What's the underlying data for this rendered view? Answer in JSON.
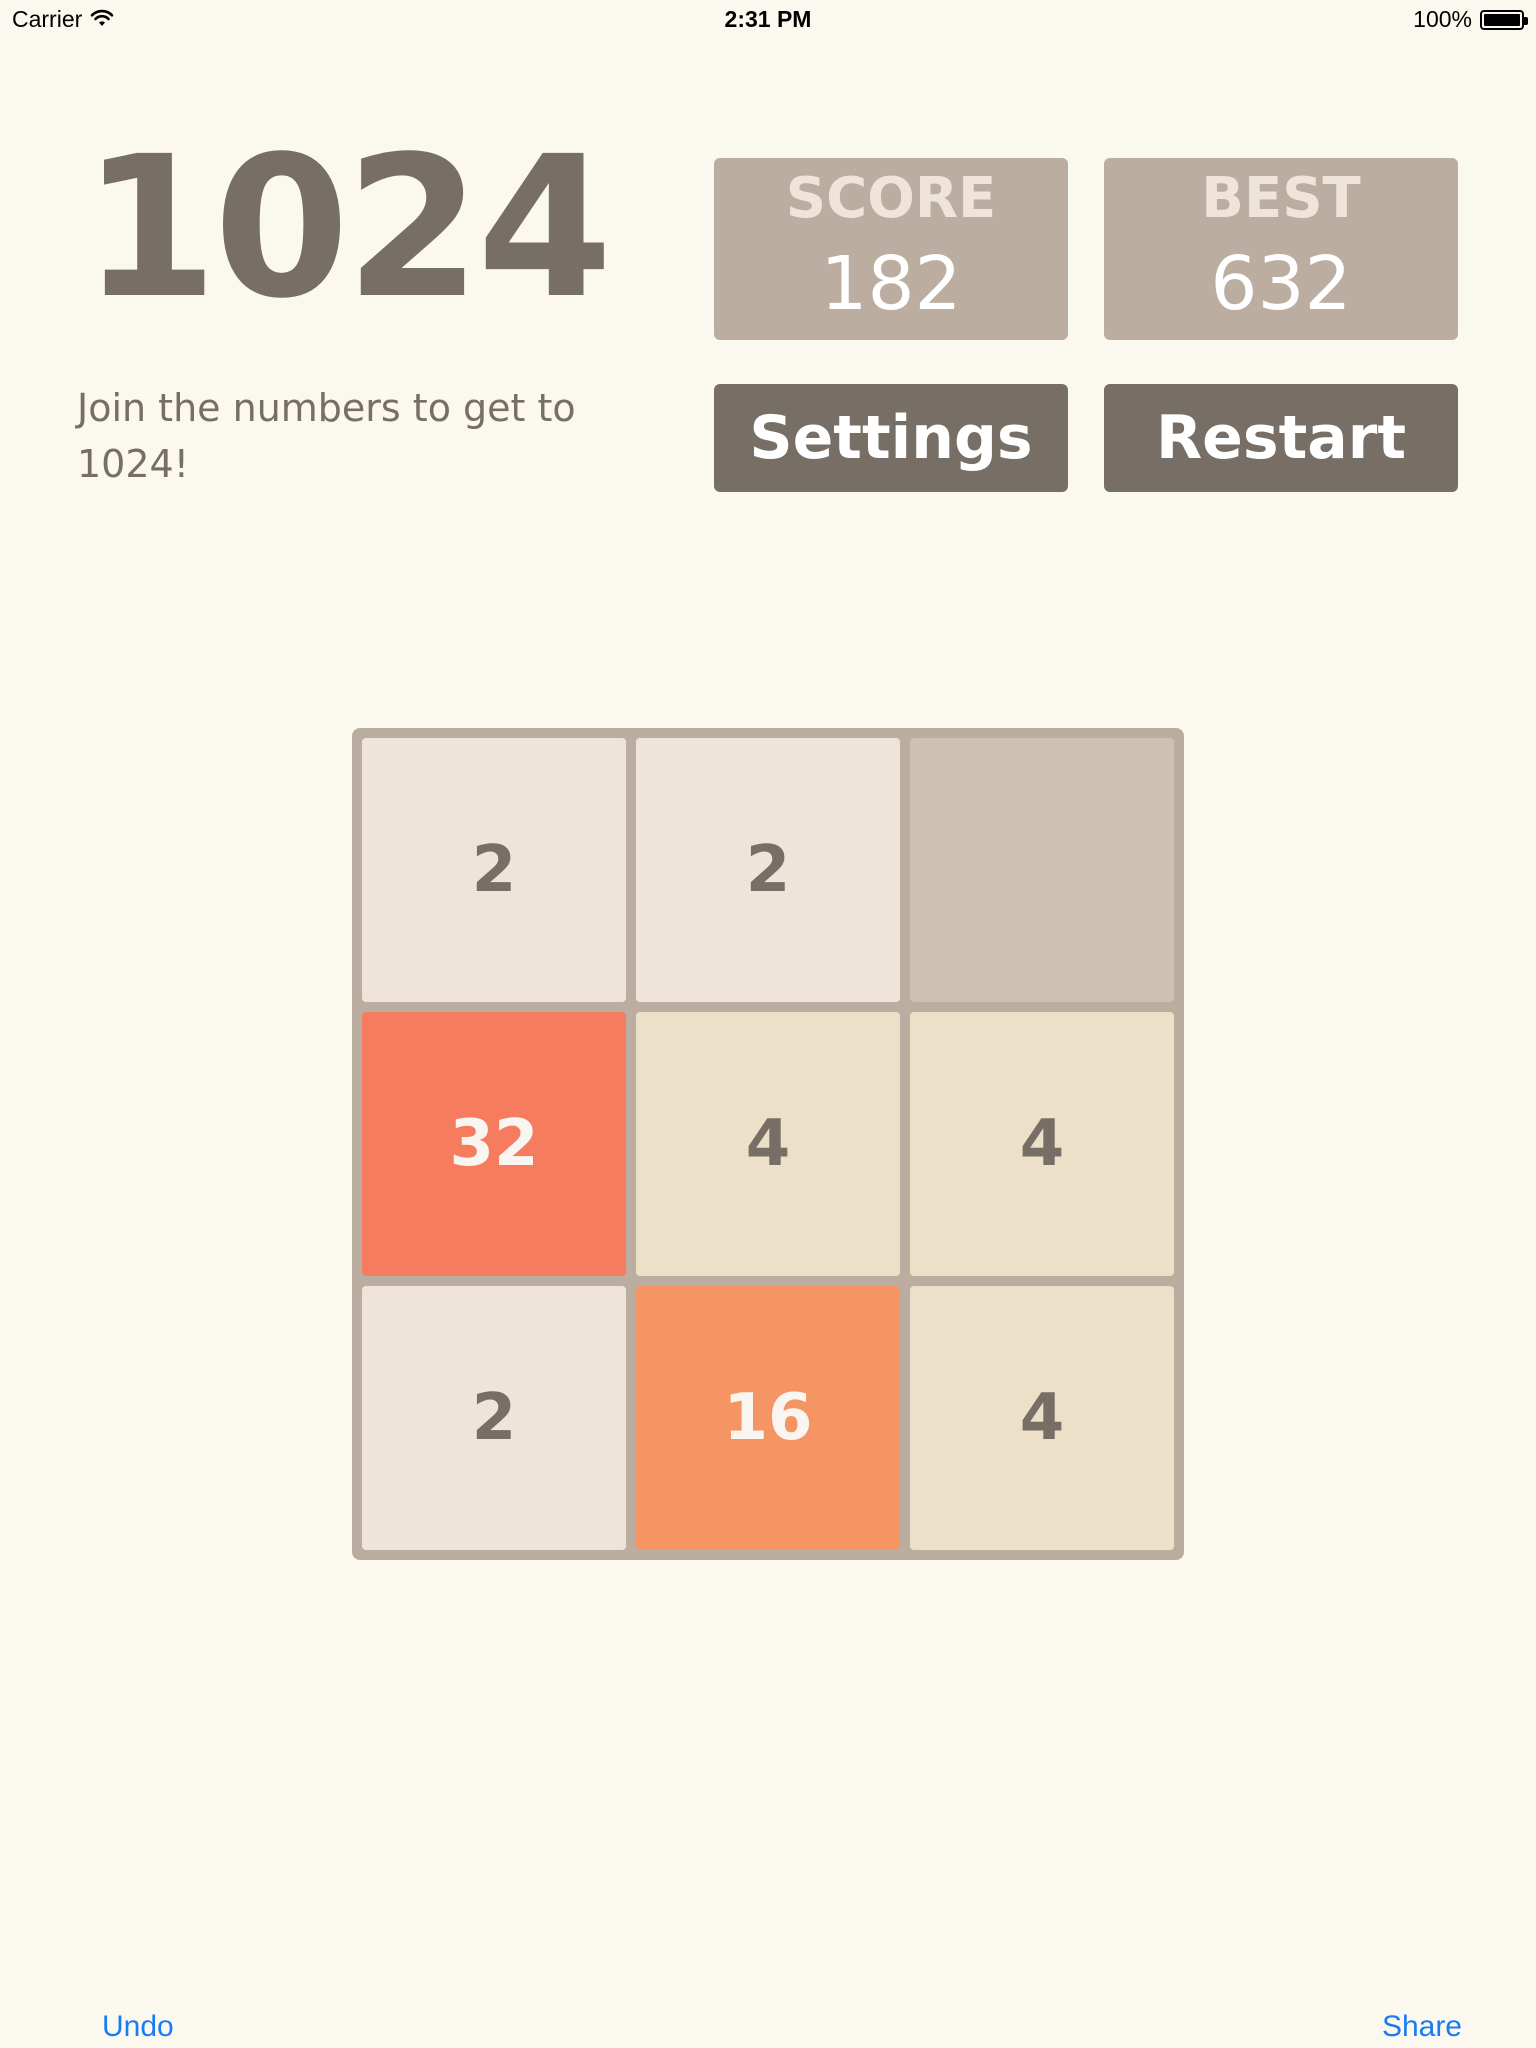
{
  "status_bar": {
    "carrier": "Carrier",
    "time": "2:31 PM",
    "battery": "100%",
    "icons": [
      "wifi-icon",
      "battery-icon"
    ]
  },
  "header": {
    "title": "1024",
    "subtitle": "Join the numbers to get to 1024!"
  },
  "scores": {
    "score_label": "SCORE",
    "score_value": "182",
    "best_label": "BEST",
    "best_value": "632"
  },
  "buttons": {
    "settings": "Settings",
    "restart": "Restart"
  },
  "board": {
    "rows": [
      [
        "2",
        "2",
        ""
      ],
      [
        "32",
        "4",
        "4"
      ],
      [
        "2",
        "16",
        "4"
      ]
    ]
  },
  "toolbar": {
    "undo": "Undo",
    "share": "Share"
  },
  "colors": {
    "background": "#fbf8ef",
    "board": "#bbada0",
    "empty_cell": "#cdc1b4",
    "tile_2": "#eee4da",
    "tile_4": "#ede0c8",
    "tile_16": "#f59563",
    "tile_32": "#f67c5f",
    "text_dark": "#776e65",
    "link_blue": "#1a7cf3"
  }
}
